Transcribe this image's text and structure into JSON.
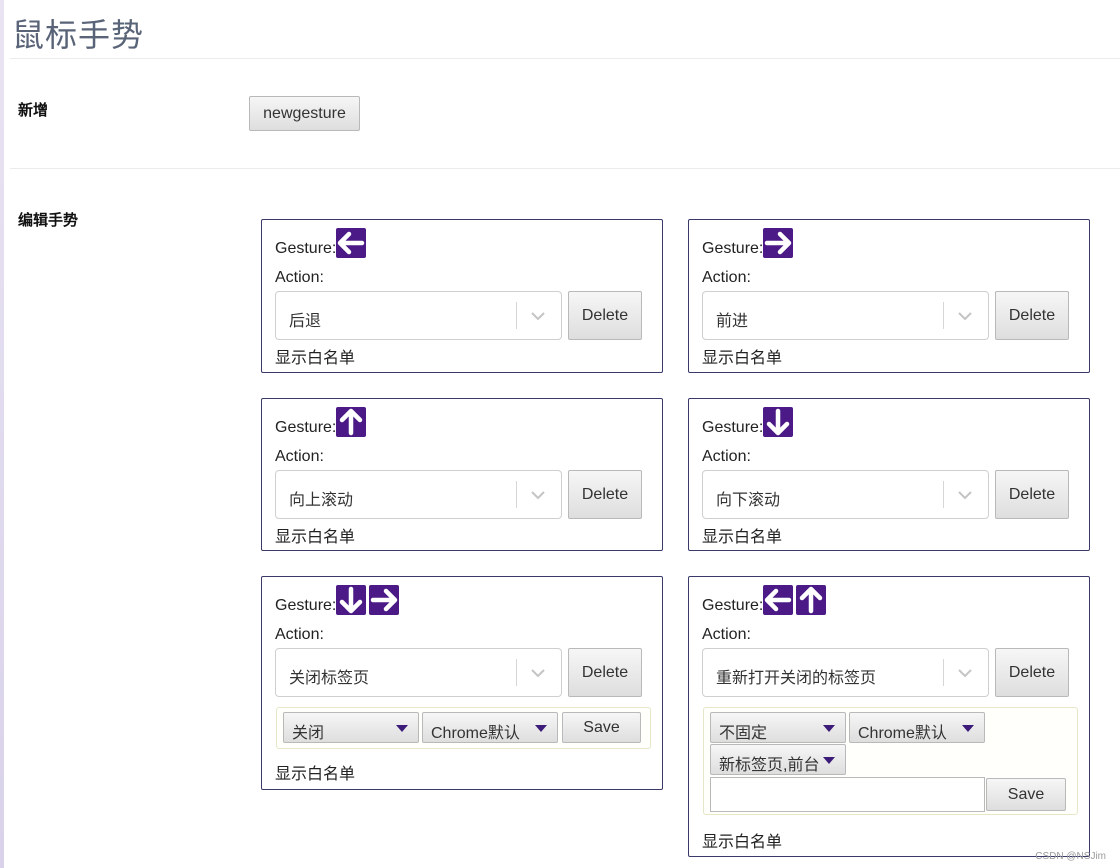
{
  "page": {
    "title": "鼠标手势"
  },
  "add_section": {
    "label": "新增",
    "button_label": "newgesture"
  },
  "edit_section": {
    "label": "编辑手势"
  },
  "labels": {
    "gesture": "Gesture:",
    "action": "Action:",
    "delete": "Delete",
    "save": "Save",
    "whitelist": "显示白名单"
  },
  "gestures": [
    {
      "arrows": [
        "left"
      ],
      "action": "后退"
    },
    {
      "arrows": [
        "right"
      ],
      "action": "前进"
    },
    {
      "arrows": [
        "up"
      ],
      "action": "向上滚动"
    },
    {
      "arrows": [
        "down"
      ],
      "action": "向下滚动"
    },
    {
      "arrows": [
        "down",
        "right"
      ],
      "action": "关闭标签页",
      "options": [
        "关闭",
        "Chrome默认"
      ]
    },
    {
      "arrows": [
        "left",
        "up"
      ],
      "action": "重新打开关闭的标签页",
      "options": [
        "不固定",
        "Chrome默认",
        "新标签页,前台"
      ],
      "input_value": ""
    }
  ],
  "watermark": "CSDN @NSJim",
  "colors": {
    "arrow_bg": "#4b1a86",
    "card_border": "#3a3a6a",
    "title_color": "#5a6478"
  }
}
